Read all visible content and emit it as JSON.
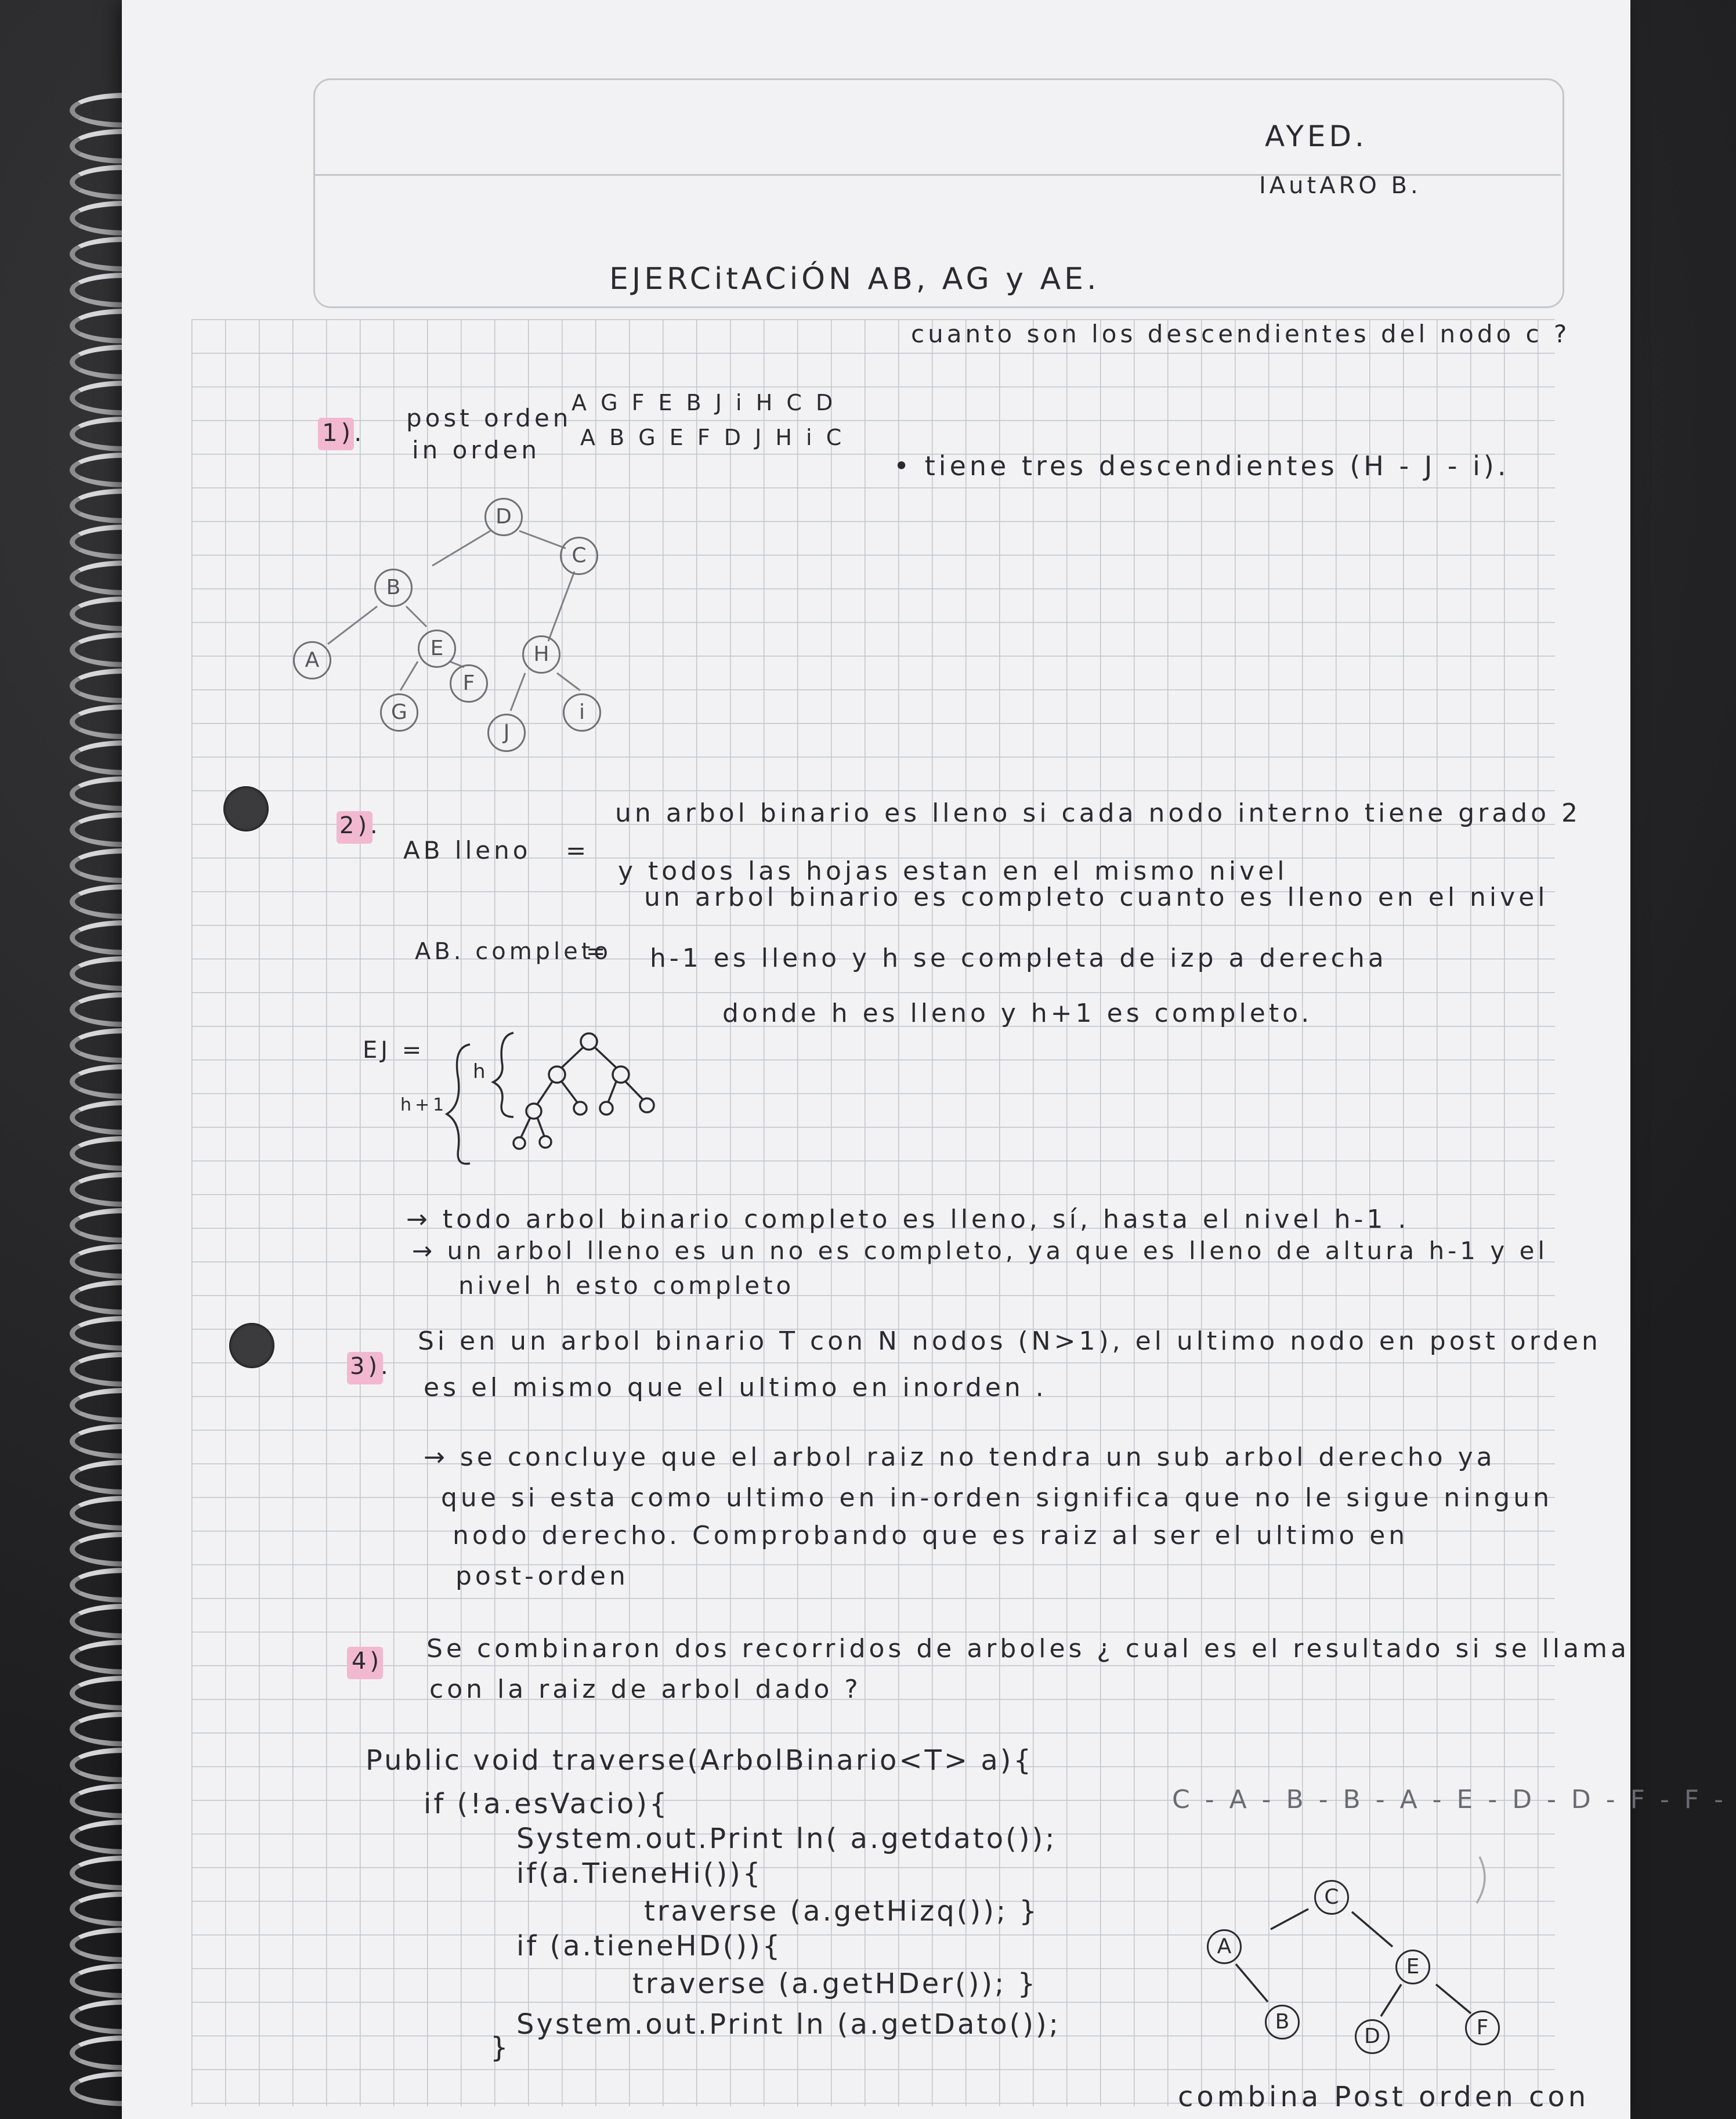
{
  "header": {
    "subject": "AYED.",
    "author": "IAutARO B.",
    "title": "EJERCitACiÓN AB, AG y AE."
  },
  "ex1": {
    "number": "1).",
    "postorder_label": "post orden",
    "postorder_seq": "A G F E B J i H C D",
    "inorder_label": "in orden",
    "inorder_seq": "A B G E F D J H i C",
    "question": "cuanto son los descendientes del nodo c ?",
    "answer": "• tiene tres descendientes (H - J - i).",
    "tree_nodes": [
      "D",
      "B",
      "C",
      "A",
      "E",
      "H",
      "G",
      "F",
      "J",
      "i"
    ]
  },
  "ex2": {
    "number": "2).",
    "full_label": "AB lleno",
    "full_eq": "=",
    "full_def_1": "un arbol binario es lleno si cada nodo interno tiene grado 2",
    "full_def_2": "y todos las hojas estan en el mismo nivel",
    "complete_label": "AB. completo",
    "complete_eq": "=",
    "complete_def_1": "un arbol binario es completo cuanto es lleno en el nivel",
    "complete_def_2": "h-1 es lleno y h se completa de izp a derecha",
    "example_label": "EJ =",
    "example_h": "h",
    "example_h1": "h+1",
    "example_note": "donde h es lleno y h+1 es completo.",
    "note_1": "→ todo arbol binario completo es lleno, sí, hasta el nivel h-1 .",
    "note_2": "→ un arbol lleno es un no es completo, ya que es lleno de altura h-1 y el",
    "note_3": "nivel h esto completo"
  },
  "ex3": {
    "number": "3).",
    "statement_1": "Si en un arbol binario T con N nodos (N>1), el ultimo nodo en post orden",
    "statement_2": "es el mismo que el ultimo en inorden .",
    "answer_1": "→ se concluye que el arbol raiz no tendra un sub arbol derecho ya",
    "answer_2": "que si esta como ultimo en in-orden significa que no le sigue ningun",
    "answer_3": "nodo derecho. Comprobando que es raiz al ser el ultimo en",
    "answer_4": "post-orden"
  },
  "ex4": {
    "number": "4)",
    "statement_1": "Se combinaron dos recorridos de arboles ¿ cual es el resultado si se llama",
    "statement_2": "con la raiz de arbol dado ?",
    "code": [
      "Public void traverse(ArbolBinario<T> a){",
      "if (!a.esVacio){",
      "System.out.Print ln( a.getdato());",
      "if(a.TieneHi()){",
      "traverse (a.getHizq()); }",
      "if (a.tieneHD()){",
      "traverse (a.getHDer()); }",
      "}",
      "System.out.Print ln (a.getDato());"
    ],
    "sequence": "C - A - B - B - A - E - D - D - F - F - E - C",
    "tree_nodes": [
      "C",
      "A",
      "E",
      "B",
      "D",
      "F"
    ],
    "caption": "combina Post orden con"
  }
}
